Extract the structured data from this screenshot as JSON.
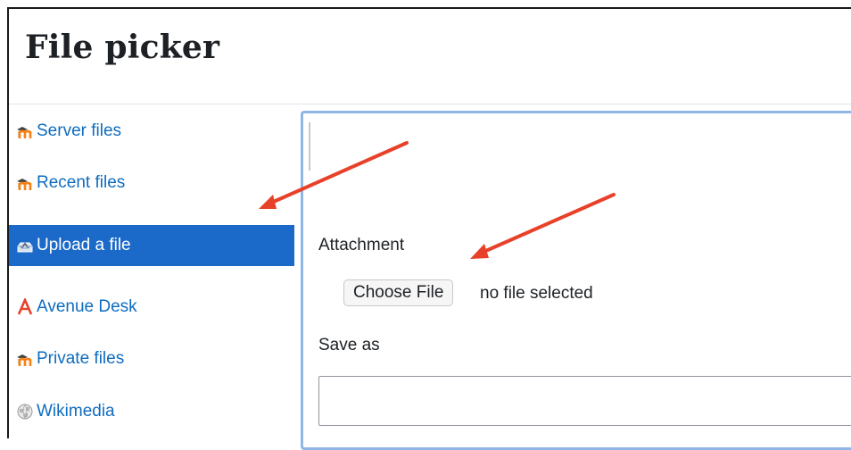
{
  "dialog": {
    "title": "File picker"
  },
  "sidebar": {
    "items": [
      {
        "label": "Server files",
        "icon": "moodle-icon",
        "active": false
      },
      {
        "label": "Recent files",
        "icon": "moodle-icon",
        "active": false
      },
      {
        "label": "Upload a file",
        "icon": "upload-icon",
        "active": true
      },
      {
        "label": "Avenue Desk",
        "icon": "avenue-icon",
        "active": false
      },
      {
        "label": "Private files",
        "icon": "moodle-icon",
        "active": false
      },
      {
        "label": "Wikimedia",
        "icon": "wikimedia-globe-icon",
        "active": false
      }
    ]
  },
  "upload": {
    "attachment_label": "Attachment",
    "choose_file_label": "Choose File",
    "file_status": "no file selected",
    "save_as_label": "Save as",
    "save_as_value": ""
  },
  "colors": {
    "link": "#0f6cbf",
    "active_bg": "#1b6ac9",
    "pane_border": "#8fb6e6",
    "annotation_arrow": "#e8412a",
    "moodle_orange": "#f98012"
  }
}
